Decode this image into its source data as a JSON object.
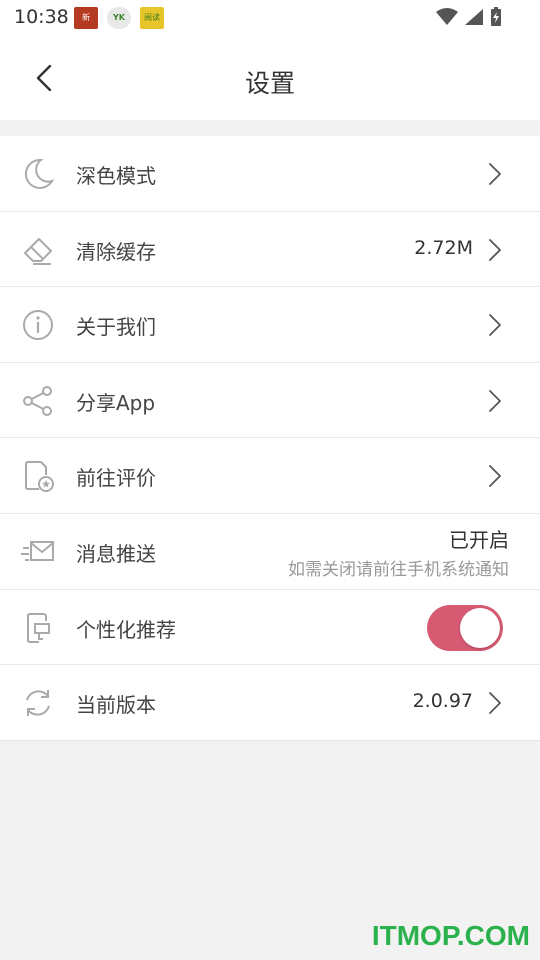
{
  "status_bar": {
    "time": "10:38",
    "notifications": [
      "news-app-icon",
      "yk-app-icon",
      "reading-app-icon"
    ],
    "notification_texts": [
      "新",
      "YK",
      "阅读"
    ]
  },
  "header": {
    "title": "设置",
    "back_icon": "chevron-left-icon"
  },
  "settings": {
    "items": [
      {
        "label": "深色模式",
        "icon": "moon-icon"
      },
      {
        "label": "清除缓存",
        "icon": "eraser-icon",
        "value": "2.72M"
      },
      {
        "label": "关于我们",
        "icon": "info-icon"
      },
      {
        "label": "分享App",
        "icon": "share-icon"
      },
      {
        "label": "前往评价",
        "icon": "rating-icon"
      },
      {
        "label": "消息推送",
        "icon": "message-icon",
        "status": "已开启",
        "hint": "如需关闭请前往手机系统通知"
      },
      {
        "label": "个性化推荐",
        "icon": "phone-recommend-icon",
        "toggle_on": true
      },
      {
        "label": "当前版本",
        "icon": "sync-icon",
        "value": "2.0.97"
      }
    ]
  },
  "colors": {
    "accent_toggle": "#d55a72",
    "watermark": "#2bb24c",
    "background": "#f2f2f2"
  },
  "watermark": "ITMOP.COM"
}
